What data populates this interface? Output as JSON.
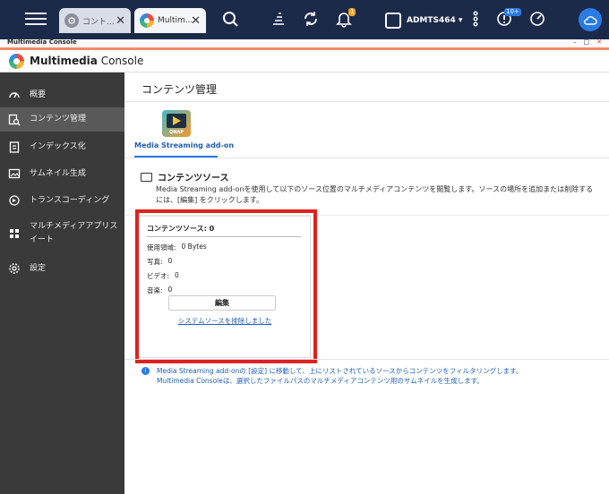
{
  "taskbar": {
    "tabs": [
      {
        "label": "コント..."
      },
      {
        "label": "Multim..."
      }
    ],
    "notification_badge": "1",
    "user": "ADMTS464",
    "user_caret": "▾",
    "resource_badge": "10+"
  },
  "window": {
    "title": "Multimedia Console",
    "controls": [
      "–",
      "□",
      "✕"
    ]
  },
  "app": {
    "title_bold": "Multimedia",
    "title_light": " Console"
  },
  "sidebar": {
    "items": [
      {
        "label": "概要"
      },
      {
        "label": "コンテンツ管理"
      },
      {
        "label": "インデックス化"
      },
      {
        "label": "サムネイル生成"
      },
      {
        "label": "トランスコーディング"
      },
      {
        "label": "マルチメディアアプリス",
        "label2": "イート"
      },
      {
        "label": "設定"
      }
    ]
  },
  "main": {
    "page_title": "コンテンツ管理",
    "plugin_label": "QNAP",
    "tab_label": "Media Streaming add-on",
    "section_title": "コンテンツソース",
    "description_line1": "Media Streaming add-onを使用して以下のソース位置のマルチメディアコンテンツを閲覧します。ソースの場所を追加または削除する",
    "description_line2": "には、[編集] をクリックします。",
    "card": {
      "title": "コンテンツソース: 0",
      "rows": [
        {
          "label": "使用領域:",
          "value": "0 Bytes"
        },
        {
          "label": "写真:",
          "value": "0"
        },
        {
          "label": "ビデオ:",
          "value": "0"
        },
        {
          "label": "音楽:",
          "value": "0"
        }
      ],
      "edit_label": "編集",
      "excluded_link": "システムソースを排除しました"
    },
    "info_line1": "Media Streaming add-onの [設定] に移動して、上にリストされているソースからコンテンツをフィルタリングします。",
    "info_line2": "Multimedia Consoleは、選択したファイルパスのマルチメディアコンテンツ用のサムネイルを生成します。"
  }
}
